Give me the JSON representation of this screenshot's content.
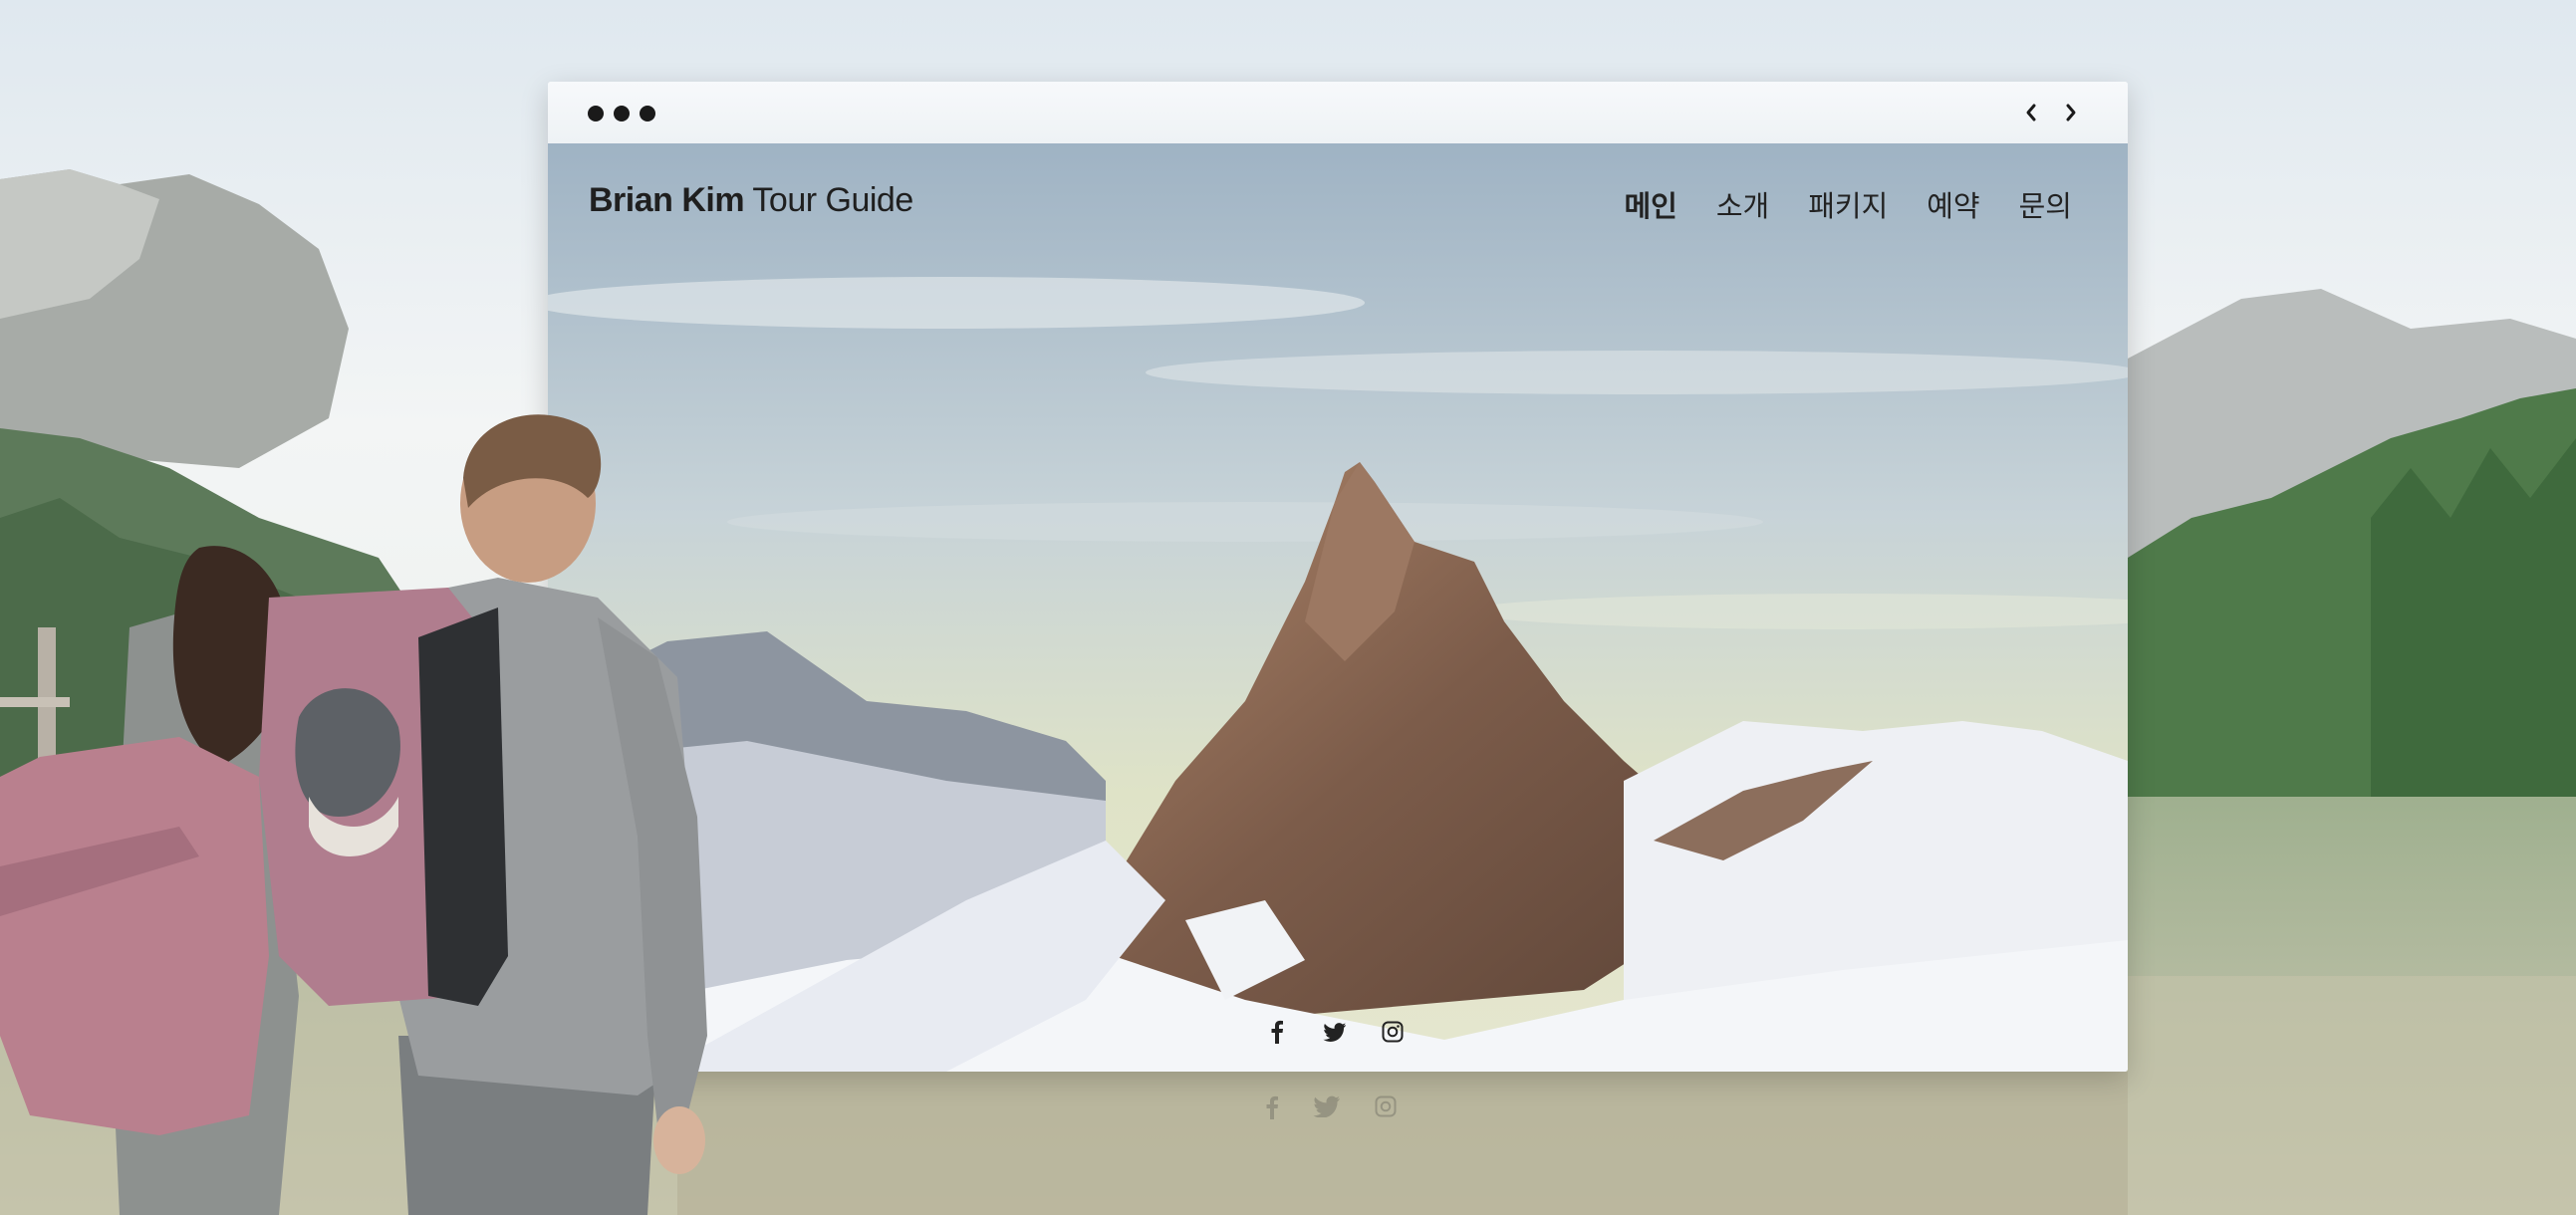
{
  "site": {
    "logo_bold": "Brian Kim",
    "logo_light": " Tour Guide",
    "nav": [
      {
        "label": "메인",
        "active": true
      },
      {
        "label": "소개",
        "active": false
      },
      {
        "label": "패키지",
        "active": false
      },
      {
        "label": "예약",
        "active": false
      },
      {
        "label": "문의",
        "active": false
      }
    ]
  },
  "browser_chrome": {
    "window_dots": 3,
    "controls": [
      "back-icon",
      "forward-icon"
    ]
  },
  "social_icons": [
    "facebook-icon",
    "twitter-icon",
    "instagram-icon"
  ],
  "colors": {
    "text": "#222222",
    "window_dots": "#1a1a1a",
    "sky_top": "#9fb3c4",
    "sky_bottom": "#dfe3c7",
    "snow": "#f2f4f7",
    "rock": "#8b6a55",
    "forest": "#4f7a4a",
    "lake": "#a3ad8e"
  }
}
